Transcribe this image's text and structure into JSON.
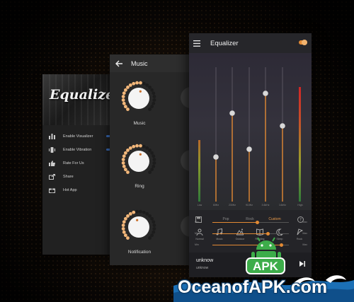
{
  "drawer": {
    "banner_title": "Equalizer",
    "items": [
      {
        "label": "Enable Visualizer",
        "icon": "visualizer-icon",
        "toggle": true
      },
      {
        "label": "Enable Vibration",
        "icon": "vibration-icon",
        "toggle": true
      },
      {
        "label": "Rate For Us",
        "icon": "thumbs-up-icon",
        "toggle": false
      },
      {
        "label": "Share",
        "icon": "share-icon",
        "toggle": false
      },
      {
        "label": "Hot App",
        "icon": "gift-icon",
        "toggle": false
      }
    ]
  },
  "volume": {
    "title": "Music",
    "knobs": [
      {
        "label": "Music",
        "level": 0.55
      },
      {
        "label": "Ring",
        "level": 0.55
      },
      {
        "label": "Notification",
        "level": 0.45
      }
    ]
  },
  "equalizer": {
    "title": "Equalizer",
    "power_on": true,
    "band_labels_bottom": [
      "Low",
      "60Hz",
      "230Hz",
      "910Hz",
      "3.6kHz",
      "14kHz",
      "High"
    ],
    "presets": [
      "Pop",
      "Rock",
      "Custom"
    ],
    "active_preset": "Custom",
    "effects": [
      {
        "label": "Normal",
        "icon": "person-icon"
      },
      {
        "label": "Music",
        "icon": "music-note-icon"
      },
      {
        "label": "Outdoor",
        "icon": "outdoor-icon"
      },
      {
        "label": "Reading",
        "icon": "book-icon"
      },
      {
        "label": "Sleep",
        "icon": "moon-icon"
      },
      {
        "label": "Rock",
        "icon": "rock-icon"
      }
    ],
    "sliders": [
      {
        "min": "Min",
        "max": "Max",
        "level": 0.58
      },
      {
        "min": "Min",
        "max": "Max",
        "level": 0.72
      },
      {
        "min": "Min",
        "max": "Max",
        "level": 0.9
      }
    ],
    "player": {
      "title": "unknow",
      "artist": "unknow"
    }
  },
  "watermark": {
    "brand": "OceanofAPK.com",
    "logo_text": "APK"
  },
  "colors": {
    "accent": "#e38a34",
    "panel": "#242428",
    "text": "#f0f0f0"
  }
}
